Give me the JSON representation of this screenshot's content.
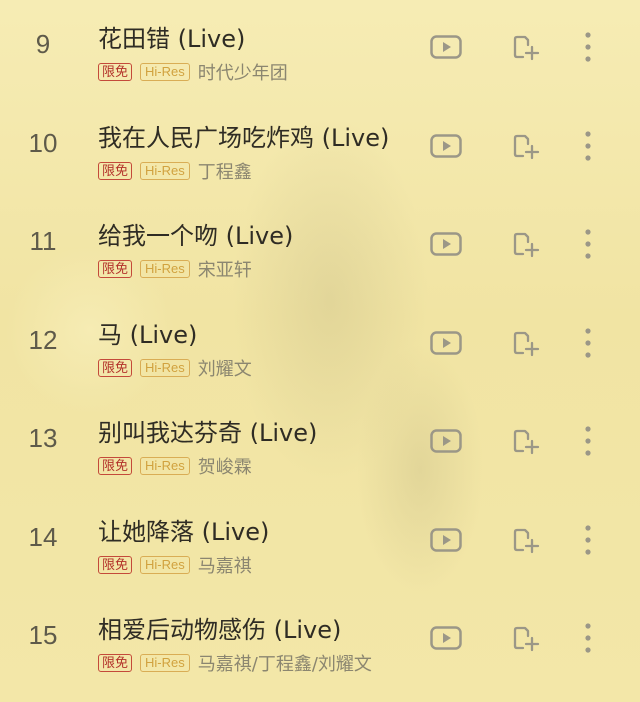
{
  "songs": [
    {
      "number": "9",
      "title": "花田错 (Live)",
      "badge_free": "限免",
      "badge_quality": "Hi-Res",
      "artist": "时代少年团"
    },
    {
      "number": "10",
      "title": "我在人民广场吃炸鸡 (Live)",
      "badge_free": "限免",
      "badge_quality": "Hi-Res",
      "artist": "丁程鑫"
    },
    {
      "number": "11",
      "title": "给我一个吻 (Live)",
      "badge_free": "限免",
      "badge_quality": "Hi-Res",
      "artist": "宋亚轩"
    },
    {
      "number": "12",
      "title": "马 (Live)",
      "badge_free": "限免",
      "badge_quality": "Hi-Res",
      "artist": "刘耀文"
    },
    {
      "number": "13",
      "title": "别叫我达芬奇 (Live)",
      "badge_free": "限免",
      "badge_quality": "Hi-Res",
      "artist": "贺峻霖"
    },
    {
      "number": "14",
      "title": "让她降落 (Live)",
      "badge_free": "限免",
      "badge_quality": "Hi-Res",
      "artist": "马嘉祺"
    },
    {
      "number": "15",
      "title": "相爱后动物感伤 (Live)",
      "badge_free": "限免",
      "badge_quality": "Hi-Res",
      "artist": "马嘉祺/丁程鑫/刘耀文"
    }
  ],
  "icons": {
    "play": "video-play-icon",
    "add": "add-to-playlist-icon",
    "more": "more-options-icon"
  },
  "colors": {
    "background": "#f4e9ad",
    "title": "#2f2c24",
    "artist": "#8b8670",
    "badge_free": "#b3322a",
    "badge_hires": "#d1a23f",
    "icon": "#9b9787"
  }
}
